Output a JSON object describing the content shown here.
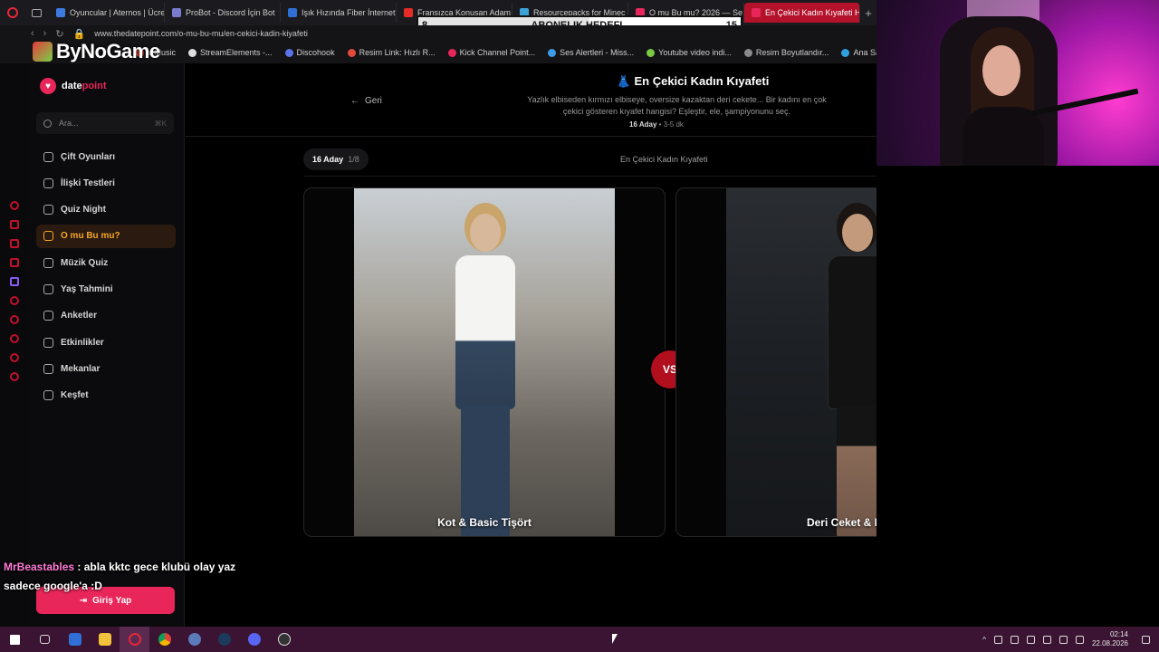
{
  "browser": {
    "tabs": [
      {
        "label": "Oyuncular | Aternos | Ücret",
        "color": "#3d7be0"
      },
      {
        "label": "ProBot - Discord İçin Bot",
        "color": "#7a7acf"
      },
      {
        "label": "Işık Hızında Fiber İnternet",
        "color": "#2f6fd6"
      },
      {
        "label": "Fransızca Konuşan Adam",
        "color": "#e52d27"
      },
      {
        "label": "Resourcepacks for Minec",
        "color": "#3ba2d8"
      },
      {
        "label": "O mu Bu mu? 2026 — Se",
        "color": "#e8265a"
      },
      {
        "label": "En Çekici Kadın Kıyafeti Ha",
        "color": "#e8265a"
      }
    ],
    "new_tab": "+",
    "url": "www.thedatepoint.com/o-mu-bu-mu/en-cekici-kadin-kiyafeti",
    "bookmarks": [
      {
        "label": "e Music",
        "color": "#e34a3a"
      },
      {
        "label": "StreamElements -...",
        "color": "#dddddd"
      },
      {
        "label": "Discohook",
        "color": "#5b73e8"
      },
      {
        "label": "Resim Link: Hızlı R...",
        "color": "#e34a3a"
      },
      {
        "label": "Kick Channel Point...",
        "color": "#e8265a"
      },
      {
        "label": "Ses Alertleri - Miss...",
        "color": "#3d9be9"
      },
      {
        "label": "Youtube video indi...",
        "color": "#7ac943"
      },
      {
        "label": "Resim Boyutlandır...",
        "color": "#8a8a8a"
      },
      {
        "label": "Ana Sayfa - Ca",
        "color": "#2fa0e0"
      }
    ]
  },
  "stream": {
    "logo_text": "ByNoGame",
    "subgoal": {
      "label": "ABONELIK HEDEFI",
      "current": "8",
      "target": "15",
      "progress_fraction": 0.53
    },
    "chat": {
      "user": "MrBeastables",
      "line1": ": abla kktc gece klubü olay yaz",
      "line2": "sadece google'a :D"
    }
  },
  "app": {
    "brand_a": "date",
    "brand_b": "point",
    "search_placeholder": "Ara...",
    "search_kbd": "⌘K",
    "nav": [
      {
        "label": "Çift Oyunları",
        "active": false
      },
      {
        "label": "İlişki Testleri",
        "active": false
      },
      {
        "label": "Quiz Night",
        "active": false
      },
      {
        "label": "O mu Bu mu?",
        "active": true
      },
      {
        "label": "Müzik Quiz",
        "active": false
      },
      {
        "label": "Yaş Tahmini",
        "active": false
      },
      {
        "label": "Anketler",
        "active": false
      },
      {
        "label": "Etkinlikler",
        "active": false
      },
      {
        "label": "Mekanlar",
        "active": false
      },
      {
        "label": "Keşfet",
        "active": false
      }
    ],
    "login_label": "Giriş Yap"
  },
  "page": {
    "back_label": "Geri",
    "title_icon": "👗",
    "title": "En Çekici Kadın Kıyafeti",
    "description": "Yazlık elbiseden kırmızı elbiseye, oversize kazaktan deri cekete... Bir kadını en çok çekici gösteren kıyafet hangisi? Eşleştir, ele, şampiyonunu seç.",
    "meta_count": "16 Aday",
    "meta_sep": "•",
    "meta_time": "3-5 dk",
    "round_pill": "16 Aday",
    "round_frac": "1/8",
    "round_title": "En Çekici Kadın Kıyafeti",
    "vs_label": "VS",
    "option_a": "Kot & Basic Tişört",
    "option_b": "Deri Ceket & Elbise"
  },
  "taskbar": {
    "time": "02:14",
    "date": "22.08.2026"
  }
}
